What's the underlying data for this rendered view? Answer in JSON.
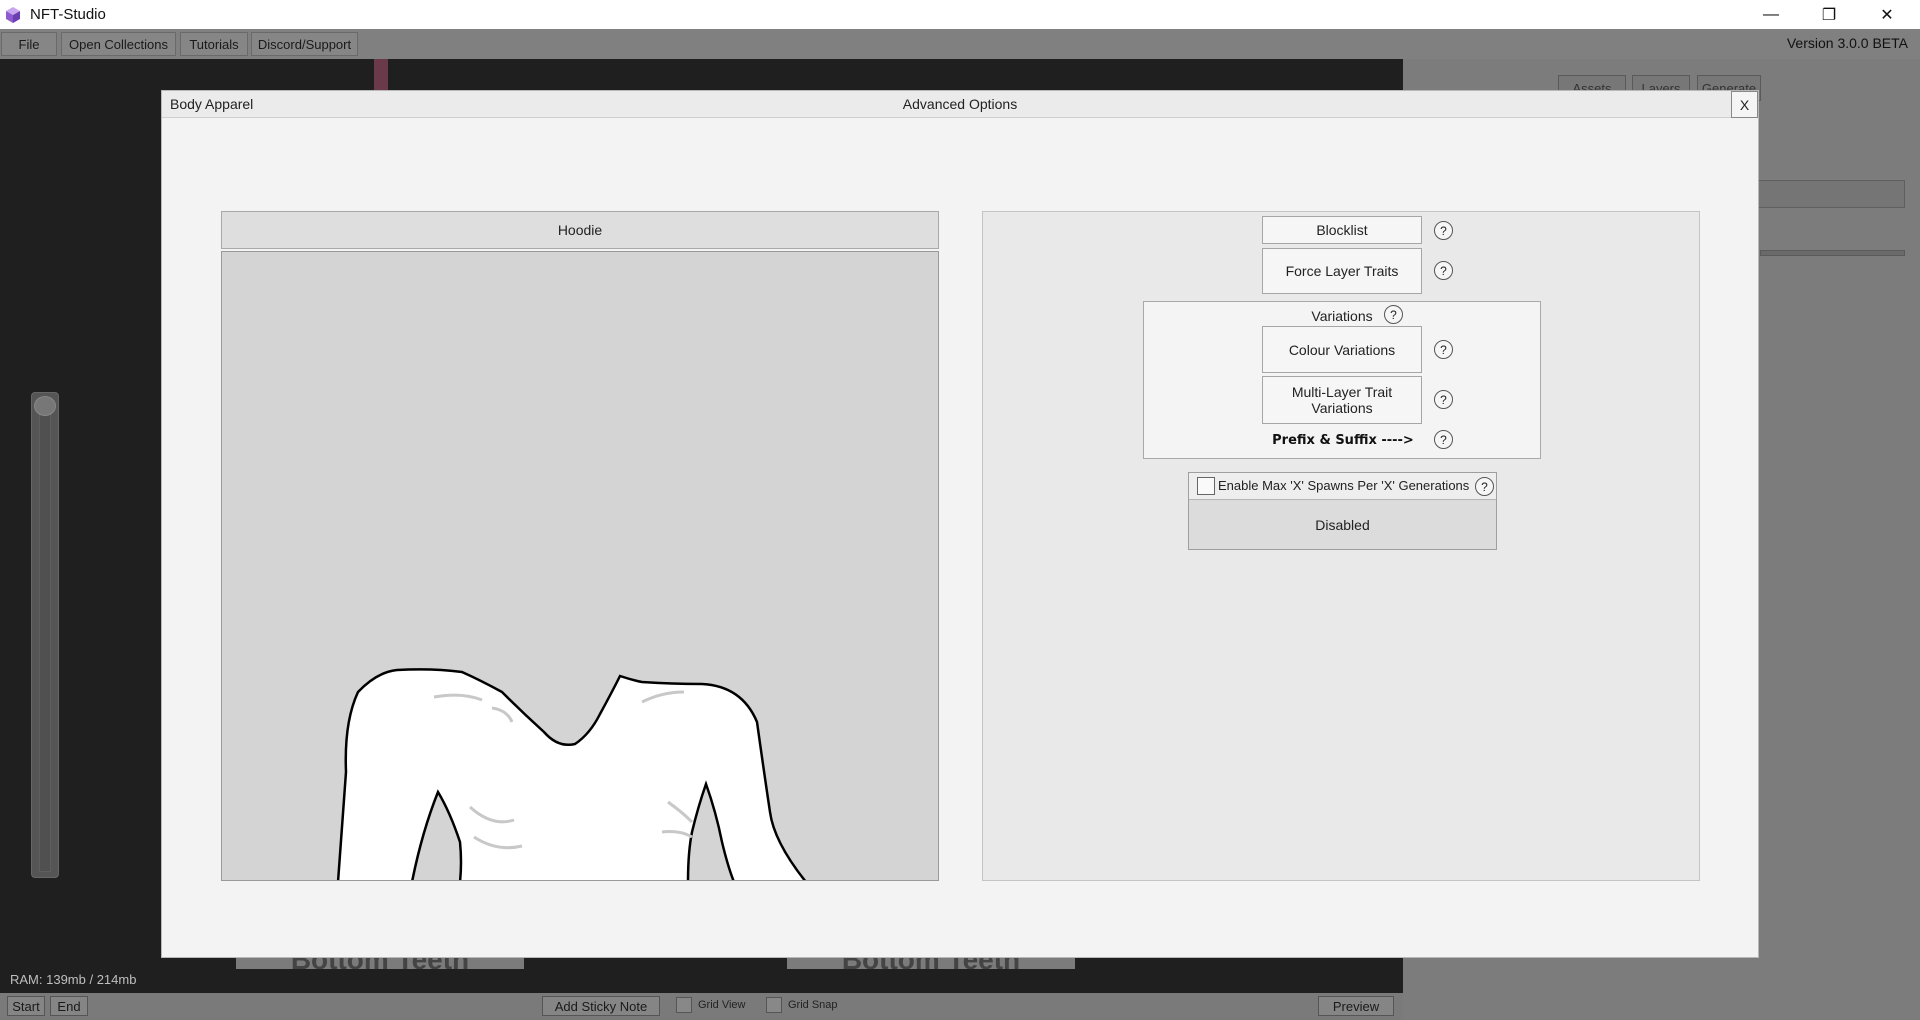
{
  "window": {
    "title": "NFT-Studio",
    "minimize_glyph": "—",
    "restore_glyph": "❐",
    "close_glyph": "✕"
  },
  "menu": {
    "items": [
      "File",
      "Open Collections",
      "Tutorials",
      "Discord/Support"
    ],
    "version": "Version 3.0.0 BETA"
  },
  "right_panel": {
    "tabs": [
      "Assets",
      "Layers",
      "Generate"
    ]
  },
  "background_nodes": [
    "Bottom Teeth",
    "Bottom Teeth"
  ],
  "status": {
    "ram": "RAM: 139mb / 214mb"
  },
  "bottom_bar": {
    "start": "Start",
    "end": "End",
    "add_sticky_note": "Add Sticky Note",
    "grid_view": "Grid View",
    "grid_snap": "Grid Snap",
    "preview": "Preview"
  },
  "modal": {
    "layer_name": "Body Apparel",
    "title": "Advanced Options",
    "close_label": "X",
    "trait_name": "Hoodie",
    "help_glyph": "?",
    "buttons": {
      "blocklist": "Blocklist",
      "force_layer_traits": "Force Layer Traits"
    },
    "variations": {
      "label": "Variations",
      "colour_variations": "Colour Variations",
      "multi_layer_trait_variations": "Multi-Layer Trait Variations",
      "prefix_suffix": "Prefix & Suffix ---->"
    },
    "max_spawns": {
      "label": "Enable Max 'X' Spawns Per 'X' Generations",
      "checked": false,
      "status": "Disabled"
    }
  },
  "colors": {
    "app_icon": "#9b6bd6",
    "modal_bg": "#f3f3f3",
    "preview_bg": "#d4d4d4",
    "hoodie_fill": "#ffffff",
    "hoodie_outline": "#000000"
  }
}
